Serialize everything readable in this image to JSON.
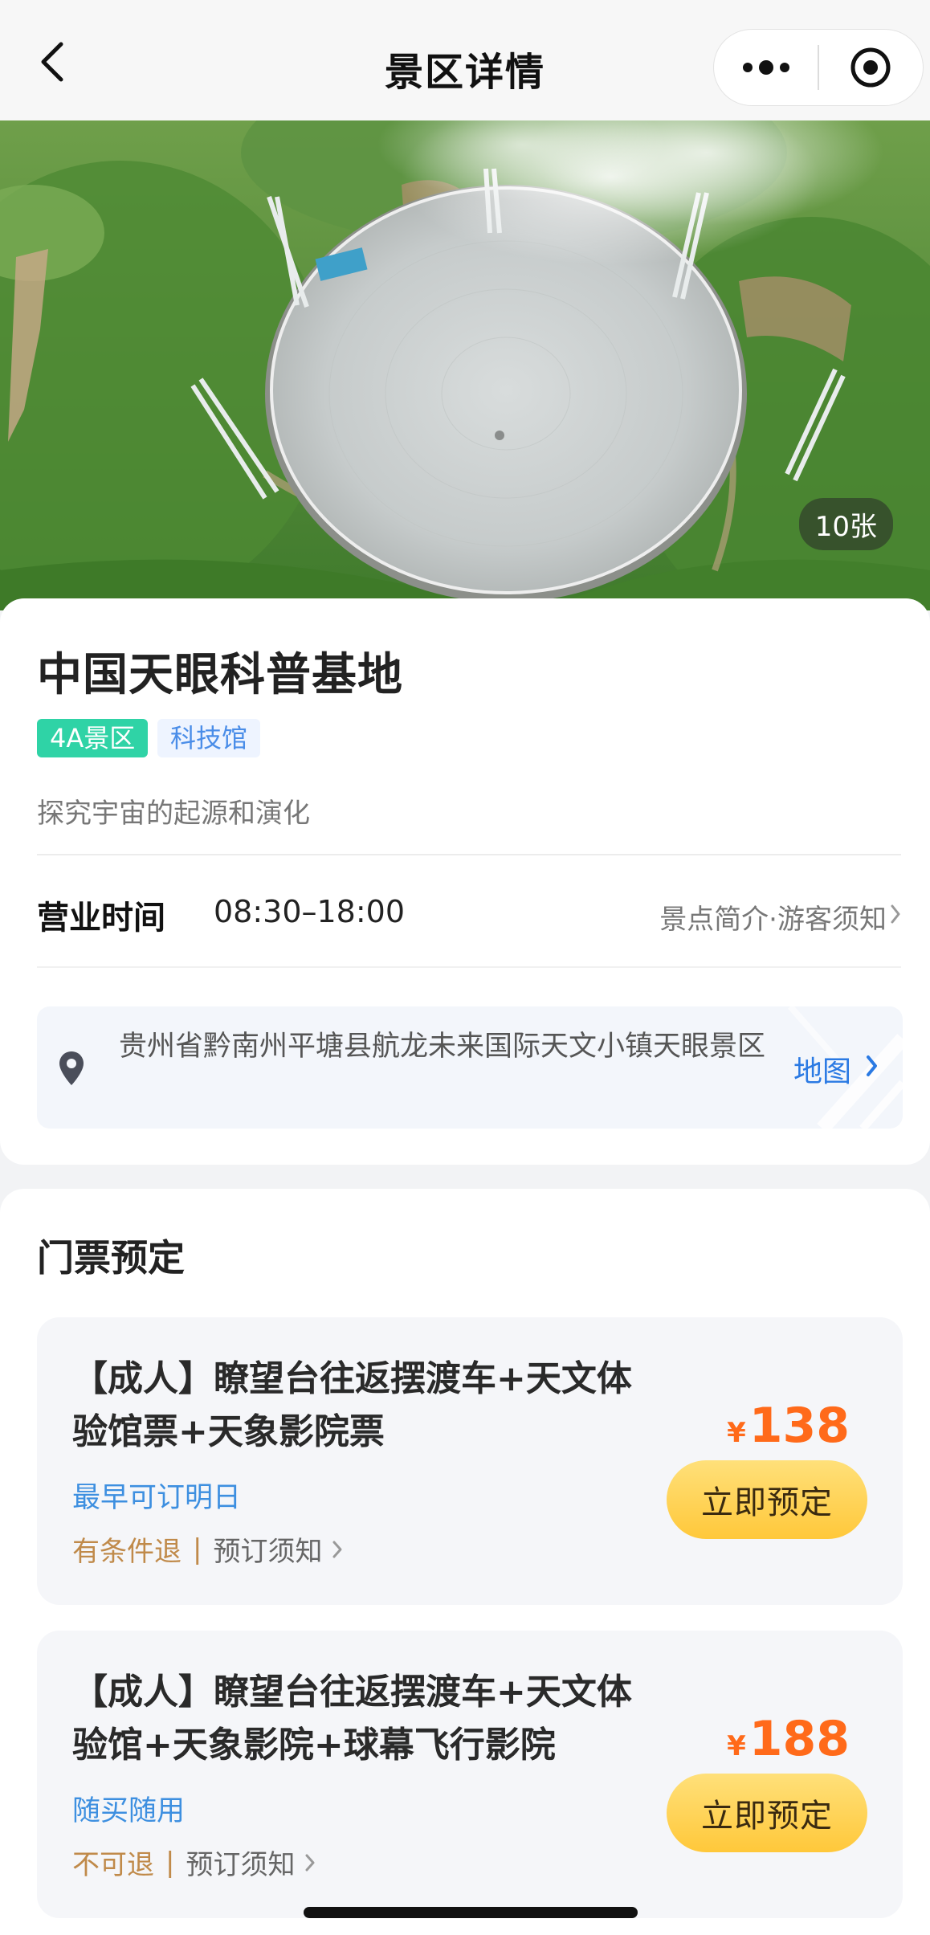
{
  "navbar": {
    "title": "景区详情",
    "back_icon": "chevron-left-icon",
    "more_icon": "more-dots-icon",
    "close_icon": "target-close-icon"
  },
  "hero": {
    "photo_count": "10张"
  },
  "poi": {
    "name": "中国天眼科普基地",
    "tags": [
      "4A景区",
      "科技馆"
    ],
    "slogan": "探究宇宙的起源和演化",
    "hours_label": "营业时间",
    "hours_value": "08:30–18:00",
    "hours_link": "景点简介·游客须知",
    "address": "贵州省黔南州平塘县航龙未来国际天文小镇天眼景区",
    "map_label": "地图"
  },
  "tickets": {
    "section_title": "门票预定",
    "items": [
      {
        "title": "【成人】瞭望台往返摆渡车+天文体验馆票+天象影院票",
        "availability": "最早可订明日",
        "refund": "有条件退",
        "notice": "预订须知",
        "currency": "¥",
        "price": "138",
        "button": "立即预定"
      },
      {
        "title": "【成人】瞭望台往返摆渡车+天文体验馆+天象影院+球幕飞行影院",
        "availability": "随买随用",
        "refund": "不可退",
        "notice": "预订须知",
        "currency": "¥",
        "price": "188",
        "button": "立即预定"
      }
    ]
  },
  "colors": {
    "accent_blue": "#2b7ae3",
    "price_orange": "#ff6a1a",
    "tag_green": "#2fd3a6",
    "button_yellow": "#ffc83a"
  }
}
